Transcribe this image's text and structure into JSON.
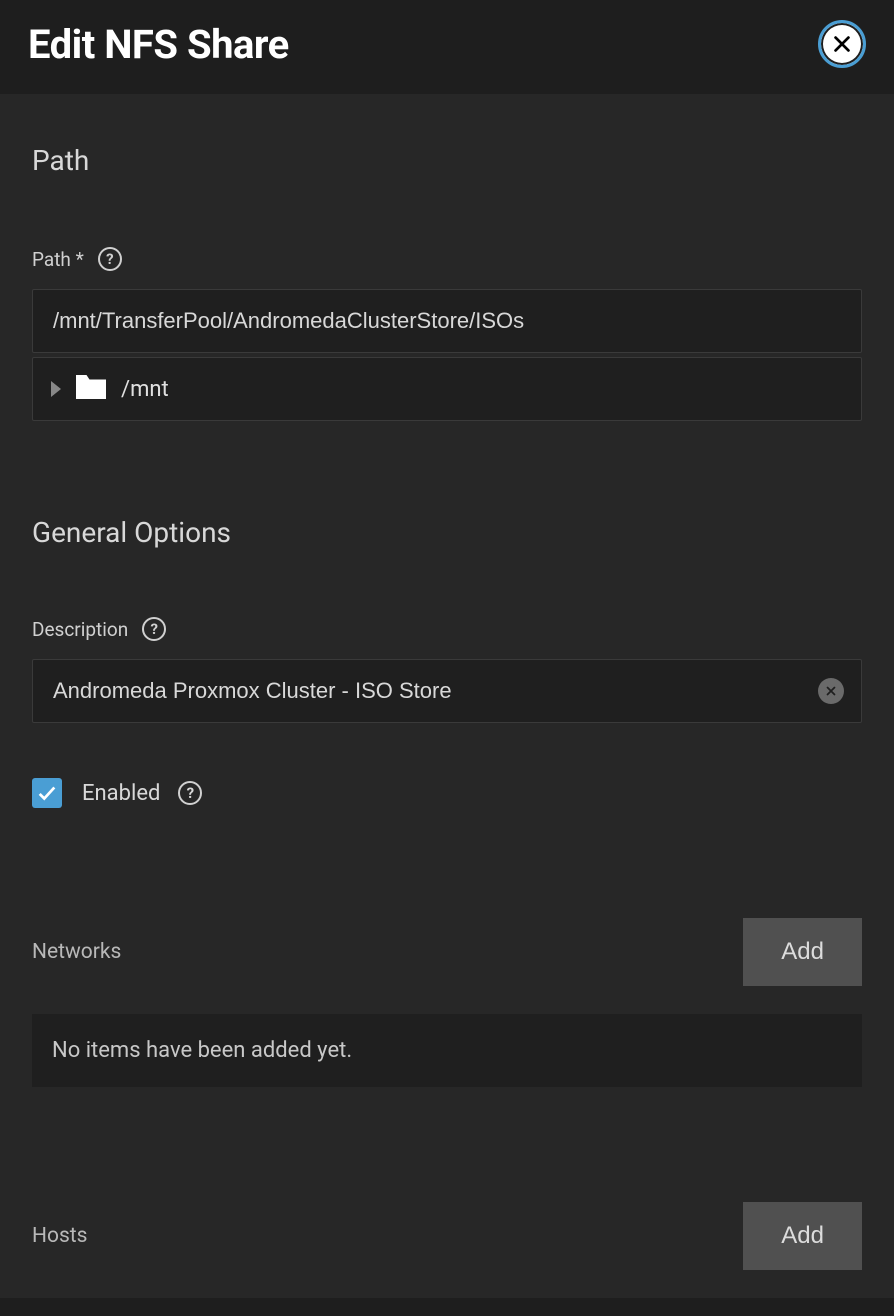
{
  "header": {
    "title": "Edit NFS Share"
  },
  "path_section": {
    "heading": "Path",
    "label": "Path *",
    "value": "/mnt/TransferPool/AndromedaClusterStore/ISOs",
    "tree_root": "/mnt"
  },
  "general_section": {
    "heading": "General Options",
    "description_label": "Description",
    "description_value": "Andromeda Proxmox Cluster - ISO Store",
    "enabled_label": "Enabled",
    "enabled_checked": true
  },
  "networks": {
    "label": "Networks",
    "add_button": "Add",
    "empty_text": "No items have been added yet."
  },
  "hosts": {
    "label": "Hosts",
    "add_button": "Add"
  }
}
